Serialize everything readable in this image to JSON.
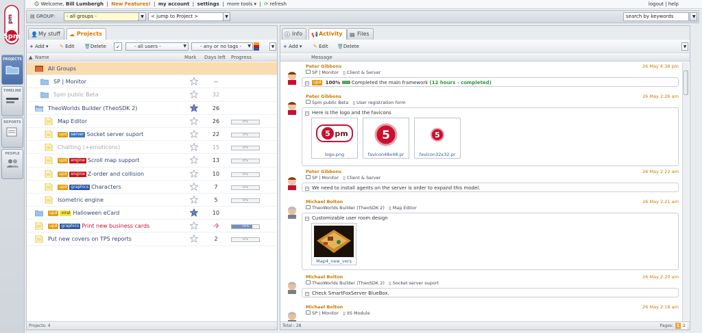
{
  "topbar": {
    "welcome": "Welcome,",
    "user": "Bill Lumbergh",
    "new_features": "New Features!",
    "my_account": "my account",
    "settings": "settings",
    "more_tools": "more tools",
    "refresh": "refresh",
    "logout": "logout",
    "help": "help"
  },
  "sidenav": {
    "logo": "5pm",
    "items": [
      {
        "label": "PROJECTS"
      },
      {
        "label": "TIMELINE"
      },
      {
        "label": "REPORTS"
      },
      {
        "label": "PEOPLE"
      }
    ]
  },
  "filter": {
    "group_label": "GROUP:",
    "group_value": "- all groups -",
    "jump_value": "< jump to Project >",
    "search_placeholder": "search by keywords"
  },
  "left": {
    "tabs": [
      {
        "label": "My stuff"
      },
      {
        "label": "Projects"
      }
    ],
    "toolbar": {
      "add": "Add",
      "edit": "Edit",
      "delete": "Delete",
      "users": "- all users -",
      "tags": "- any or no tags -"
    },
    "columns": {
      "name": "Name",
      "mark": "Mark",
      "days": "Days left",
      "progress": "Progress"
    },
    "rows": [
      {
        "title": "All Groups",
        "days": "",
        "progress": "",
        "mark": false
      },
      {
        "title": "SP | Monitor",
        "days": "--",
        "progress": "",
        "mark": false
      },
      {
        "title": "5pm public Beta",
        "days": "32",
        "progress": "",
        "mark": false
      },
      {
        "title": "TheoWorlds Builder (TheoSDK 2)",
        "days": "26",
        "progress": "",
        "mark": true
      },
      {
        "title": "Map Editor",
        "days": "26",
        "progress": "0%",
        "progress_value": 0,
        "mark": false
      },
      {
        "title": "Socket server suport",
        "days": "22",
        "progress": "0%",
        "progress_value": 0,
        "mark": false,
        "tags": [
          "upd",
          "server"
        ]
      },
      {
        "title": "Chatting (+emoticons)",
        "days": "15",
        "progress": "0%",
        "progress_value": 0,
        "mark": false
      },
      {
        "title": "Scroll map support",
        "days": "13",
        "progress": "0%",
        "progress_value": 0,
        "mark": false,
        "tags": [
          "upd",
          "engine"
        ]
      },
      {
        "title": "Z-order and collision",
        "days": "10",
        "progress": "0%",
        "progress_value": 0,
        "mark": false,
        "tags": [
          "upd",
          "engine"
        ]
      },
      {
        "title": "Characters",
        "days": "7",
        "progress": "0%",
        "progress_value": 0,
        "mark": false,
        "tags": [
          "upd",
          "graphics"
        ]
      },
      {
        "title": "Isometric engine",
        "days": "5",
        "progress": "0%",
        "progress_value": 0,
        "mark": false
      },
      {
        "title": "Halloween eCard",
        "days": "10",
        "progress": "",
        "mark": true,
        "tags": [
          "upd",
          "viral"
        ]
      },
      {
        "title": "Print new business cards",
        "days": "-9",
        "progress": "75%",
        "progress_value": 75,
        "mark": false,
        "tags": [
          "upd",
          "graphics"
        ]
      },
      {
        "title": "Put new covers on TPS reports",
        "days": "2",
        "progress": "0%",
        "progress_value": 0,
        "mark": false
      }
    ],
    "footer": "Projects: 4"
  },
  "right": {
    "tabs": [
      {
        "label": "Info"
      },
      {
        "label": "Activity"
      },
      {
        "label": "Files"
      }
    ],
    "toolbar": {
      "add": "Add",
      "edit": "Edit",
      "delete": "Delete"
    },
    "column": "Message",
    "messages": [
      {
        "author": "Peter Gibbons",
        "date": "26 May 4:38 pm",
        "crumb1": "SP | Monitor",
        "crumb2": "Client & Server",
        "badge": "upd",
        "pct": "100%",
        "text": "Completed the main framework",
        "extra": "(12 hours - completed)"
      },
      {
        "author": "Peter Gibbons",
        "date": "26 May 2:26 am",
        "crumb1": "5pm public Beta",
        "crumb2": "User registration form",
        "text": "Here is the logo and the favicons",
        "files": [
          "logo.png",
          "favicon48x48.pr",
          "favicon32x32.pr"
        ]
      },
      {
        "author": "Peter Gibbons",
        "date": "26 May 2:22 am",
        "crumb1": "SP | Monitor",
        "crumb2": "Client & Server",
        "text": "We need to install agents on the server is order to expand this model."
      },
      {
        "author": "Michael Bolton",
        "date": "26 May 2:21 am",
        "crumb1": "TheoWorlds Builder (TheoSDK 2)",
        "crumb2": "Map Editor",
        "text": "Customizable user room design",
        "files": [
          "Map4_new_vers"
        ]
      },
      {
        "author": "Michael Bolton",
        "date": "26 May 2:20 am",
        "crumb1": "TheoWorlds Builder (TheoSDK 2)",
        "crumb2": "Socket server suport",
        "text": "Check SmartFoxServer BlueBox."
      },
      {
        "author": "Michael Bolton",
        "date": "26 May 2:18 am",
        "crumb1": "SP | Monitor",
        "crumb2": "IIS Module",
        "text": ""
      }
    ],
    "footer_total": "Total : 28",
    "footer_pages": "Pages:",
    "pages": [
      "1",
      "2"
    ]
  }
}
